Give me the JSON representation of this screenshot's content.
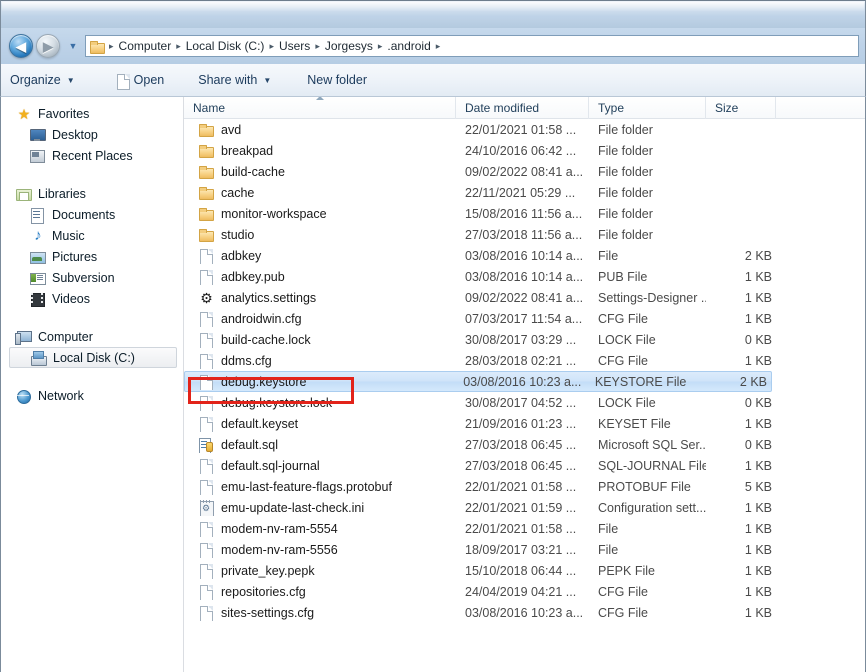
{
  "window": {
    "title": ""
  },
  "nav": {
    "back_label": "◀",
    "forward_label": "▶",
    "recent_caret": "▼",
    "separator": "▸",
    "breadcrumbs": [
      "Computer",
      "Local Disk (C:)",
      "Users",
      "Jorgesys",
      ".android"
    ]
  },
  "toolbar": {
    "organize_label": "Organize",
    "organize_caret": "▼",
    "open_label": "Open",
    "share_label": "Share with",
    "share_caret": "▼",
    "newfolder_label": "New folder"
  },
  "sidebar": {
    "groups": [
      {
        "header": {
          "label": "Favorites",
          "icon": "star-icon"
        },
        "items": [
          {
            "label": "Desktop",
            "icon": "desktop-icon"
          },
          {
            "label": "Recent Places",
            "icon": "recent-places-icon"
          }
        ]
      },
      {
        "header": {
          "label": "Libraries",
          "icon": "libraries-icon"
        },
        "items": [
          {
            "label": "Documents",
            "icon": "documents-icon"
          },
          {
            "label": "Music",
            "icon": "music-icon"
          },
          {
            "label": "Pictures",
            "icon": "pictures-icon"
          },
          {
            "label": "Subversion",
            "icon": "subversion-icon"
          },
          {
            "label": "Videos",
            "icon": "videos-icon"
          }
        ]
      },
      {
        "header": {
          "label": "Computer",
          "icon": "computer-icon"
        },
        "items": [
          {
            "label": "Local Disk (C:)",
            "icon": "disk-icon",
            "selected": true
          }
        ]
      },
      {
        "header": {
          "label": "Network",
          "icon": "network-icon"
        },
        "items": []
      }
    ]
  },
  "filelist": {
    "columns": {
      "name": "Name",
      "date_modified": "Date modified",
      "type": "Type",
      "size": "Size"
    },
    "sort": {
      "column": "Name",
      "direction": "ascending"
    },
    "rows": [
      {
        "name": "avd",
        "date": "22/01/2021 01:58 ...",
        "type": "File folder",
        "size": "",
        "icon": "folder-icon",
        "selected": false
      },
      {
        "name": "breakpad",
        "date": "24/10/2016 06:42 ...",
        "type": "File folder",
        "size": "",
        "icon": "folder-icon",
        "selected": false
      },
      {
        "name": "build-cache",
        "date": "09/02/2022 08:41 a...",
        "type": "File folder",
        "size": "",
        "icon": "folder-icon",
        "selected": false
      },
      {
        "name": "cache",
        "date": "22/11/2021 05:29 ...",
        "type": "File folder",
        "size": "",
        "icon": "folder-icon",
        "selected": false
      },
      {
        "name": "monitor-workspace",
        "date": "15/08/2016 11:56 a...",
        "type": "File folder",
        "size": "",
        "icon": "folder-icon",
        "selected": false
      },
      {
        "name": "studio",
        "date": "27/03/2018 11:56 a...",
        "type": "File folder",
        "size": "",
        "icon": "folder-icon",
        "selected": false
      },
      {
        "name": "adbkey",
        "date": "03/08/2016 10:14 a...",
        "type": "File",
        "size": "2 KB",
        "icon": "document-icon",
        "selected": false
      },
      {
        "name": "adbkey.pub",
        "date": "03/08/2016 10:14 a...",
        "type": "PUB File",
        "size": "1 KB",
        "icon": "document-icon",
        "selected": false
      },
      {
        "name": "analytics.settings",
        "date": "09/02/2022 08:41 a...",
        "type": "Settings-Designer ...",
        "size": "1 KB",
        "icon": "gear-icon",
        "selected": false
      },
      {
        "name": "androidwin.cfg",
        "date": "07/03/2017 11:54 a...",
        "type": "CFG File",
        "size": "1 KB",
        "icon": "document-icon",
        "selected": false
      },
      {
        "name": "build-cache.lock",
        "date": "30/08/2017 03:29 ...",
        "type": "LOCK File",
        "size": "0 KB",
        "icon": "document-icon",
        "selected": false
      },
      {
        "name": "ddms.cfg",
        "date": "28/03/2018 02:21 ...",
        "type": "CFG File",
        "size": "1 KB",
        "icon": "document-icon",
        "selected": false
      },
      {
        "name": "debug.keystore",
        "date": "03/08/2016 10:23 a...",
        "type": "KEYSTORE File",
        "size": "2 KB",
        "icon": "document-icon",
        "selected": true
      },
      {
        "name": "debug.keystore.lock",
        "date": "30/08/2017 04:52 ...",
        "type": "LOCK File",
        "size": "0 KB",
        "icon": "document-icon",
        "selected": false
      },
      {
        "name": "default.keyset",
        "date": "21/09/2016 01:23 ...",
        "type": "KEYSET File",
        "size": "1 KB",
        "icon": "document-icon",
        "selected": false
      },
      {
        "name": "default.sql",
        "date": "27/03/2018 06:45 ...",
        "type": "Microsoft SQL Ser...",
        "size": "0 KB",
        "icon": "sql-icon",
        "selected": false
      },
      {
        "name": "default.sql-journal",
        "date": "27/03/2018 06:45 ...",
        "type": "SQL-JOURNAL File",
        "size": "1 KB",
        "icon": "document-icon",
        "selected": false
      },
      {
        "name": "emu-last-feature-flags.protobuf",
        "date": "22/01/2021 01:58 ...",
        "type": "PROTOBUF File",
        "size": "5 KB",
        "icon": "document-icon",
        "selected": false
      },
      {
        "name": "emu-update-last-check.ini",
        "date": "22/01/2021 01:59 ...",
        "type": "Configuration sett...",
        "size": "1 KB",
        "icon": "ini-icon",
        "selected": false
      },
      {
        "name": "modem-nv-ram-5554",
        "date": "22/01/2021 01:58 ...",
        "type": "File",
        "size": "1 KB",
        "icon": "document-icon",
        "selected": false
      },
      {
        "name": "modem-nv-ram-5556",
        "date": "18/09/2017 03:21 ...",
        "type": "File",
        "size": "1 KB",
        "icon": "document-icon",
        "selected": false
      },
      {
        "name": "private_key.pepk",
        "date": "15/10/2018 06:44 ...",
        "type": "PEPK File",
        "size": "1 KB",
        "icon": "document-icon",
        "selected": false
      },
      {
        "name": "repositories.cfg",
        "date": "24/04/2019 04:21 ...",
        "type": "CFG File",
        "size": "1 KB",
        "icon": "document-icon",
        "selected": false
      },
      {
        "name": "sites-settings.cfg",
        "date": "03/08/2016 10:23 a...",
        "type": "CFG File",
        "size": "1 KB",
        "icon": "document-icon",
        "selected": false
      }
    ]
  },
  "annotation": {
    "shape": "rectangle",
    "color": "#e2231a",
    "targets": "debug.keystore"
  }
}
